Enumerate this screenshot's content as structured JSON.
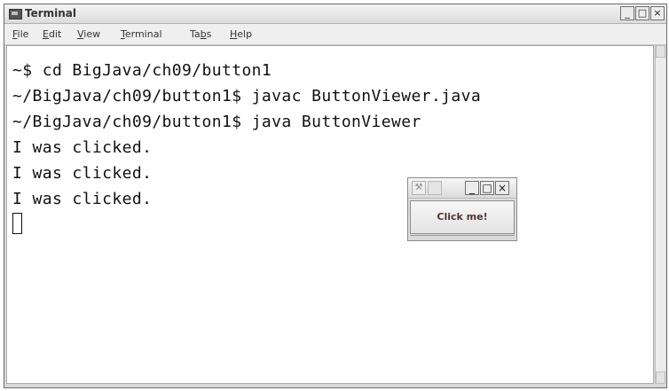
{
  "window": {
    "title": "Terminal",
    "controls": [
      "_",
      "□",
      "×"
    ]
  },
  "menubar": {
    "items": [
      {
        "label": "File",
        "mnemonic": "F",
        "rest": "ile"
      },
      {
        "label": "Edit",
        "mnemonic": "E",
        "rest": "dit"
      },
      {
        "label": "View",
        "mnemonic": "V",
        "rest": "iew"
      },
      {
        "label": "Terminal",
        "mnemonic": "T",
        "rest": "erminal"
      },
      {
        "label": "Tabs",
        "mnemonic": "b",
        "prefix": "Ta",
        "rest": "s"
      },
      {
        "label": "Help",
        "mnemonic": "H",
        "rest": "elp"
      }
    ]
  },
  "terminal": {
    "lines": [
      "~$ cd BigJava/ch09/button1",
      "~/BigJava/ch09/button1$ javac ButtonViewer.java",
      "~/BigJava/ch09/button1$ java ButtonViewer",
      "I was clicked.",
      "I was clicked.",
      "I was clicked."
    ]
  },
  "button_viewer": {
    "controls": [
      "_",
      "□",
      "×"
    ],
    "button_label": "Click me!"
  },
  "colors": {
    "terminal_bg": "#ffffff",
    "text": "#111111",
    "chrome": "#d9d9d9"
  }
}
